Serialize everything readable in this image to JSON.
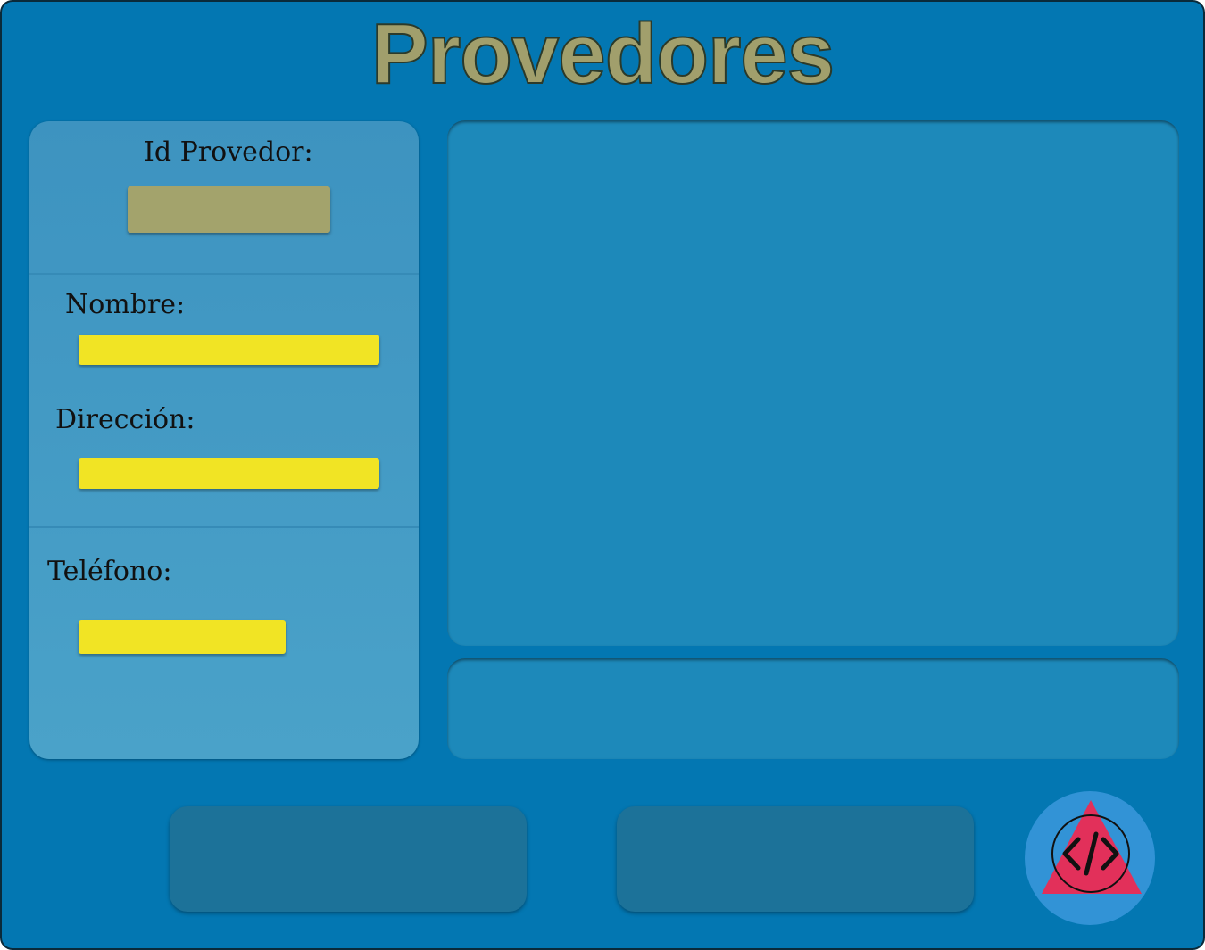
{
  "header": {
    "title": "Provedores"
  },
  "form": {
    "id_label": "Id Provedor:",
    "id_value": "",
    "name_label": "Nombre:",
    "name_value": "",
    "address_label": "Dirección:",
    "address_value": "",
    "phone_label": "Teléfono:",
    "phone_value": ""
  },
  "icons": {
    "logo": "code-triangle-logo-icon"
  },
  "colors": {
    "background": "#0377b2",
    "title": "#a19f6c",
    "form_panel": "#4aa2c9",
    "id_field": "#a3a36c",
    "input_field": "#f1e424",
    "content_panel": "#1d89ba",
    "button": "#1c7299",
    "logo_circle": "#3293d6",
    "logo_triangle": "#e2305a"
  }
}
